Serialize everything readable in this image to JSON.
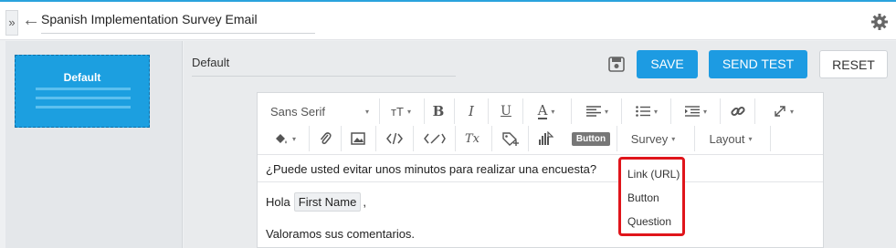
{
  "header": {
    "expand_glyph": "»",
    "back_glyph": "←",
    "title": "Spanish Implementation Survey Email"
  },
  "sidebar": {
    "template_label": "Default"
  },
  "main": {
    "template_name": "Default",
    "buttons": {
      "save": "SAVE",
      "send_test": "SEND TEST",
      "reset": "RESET"
    }
  },
  "toolbar": {
    "font": "Sans Serif",
    "font_size_glyph": "тT",
    "bold": "B",
    "italic": "I",
    "underline": "U",
    "text_color": "A",
    "clear_format": "Tx",
    "button_chip": "Button",
    "survey": "Survey",
    "layout": "Layout",
    "caret": "▾"
  },
  "editor": {
    "subject": "¿Puede usted evitar unos minutos para realizar una encuesta?",
    "greeting_prefix": "Hola",
    "merge_tag": "First Name",
    "greeting_suffix": ",",
    "body_line": "Valoramos sus comentarios."
  },
  "survey_menu": {
    "items": [
      "Link (URL)",
      "Button",
      "Question"
    ]
  },
  "colors": {
    "accent": "#1d9be2",
    "highlight": "#e0151b",
    "top_border": "#2aa3dd"
  }
}
